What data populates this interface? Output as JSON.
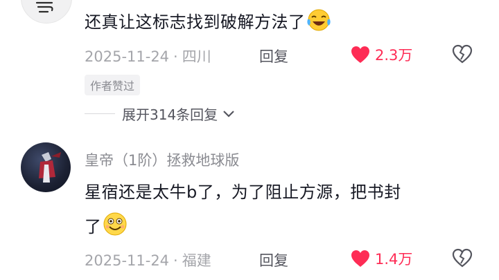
{
  "comments": [
    {
      "username": "",
      "text": "还真让这标志找到破解方法了",
      "date": "2025-11-24",
      "location": "四川",
      "reply_label": "回复",
      "likes": "2.3万",
      "author_liked_tag": "作者赞过",
      "expand_label": "展开314条回复",
      "emoji_icon": "laughing-tears-emoji-icon"
    },
    {
      "username": "皇帝（1阶）拯救地球版",
      "text_line1": "星宿还是太牛b了，为了阻止方源，把书封",
      "text_line2": "了",
      "date": "2025-11-24",
      "location": "福建",
      "reply_label": "回复",
      "likes": "1.4万",
      "emoji_icon": "smile-emoji-icon"
    }
  ],
  "colors": {
    "like_red": "#fe2c55",
    "meta_gray": "#a4a5aa",
    "text_dark": "#161823"
  }
}
